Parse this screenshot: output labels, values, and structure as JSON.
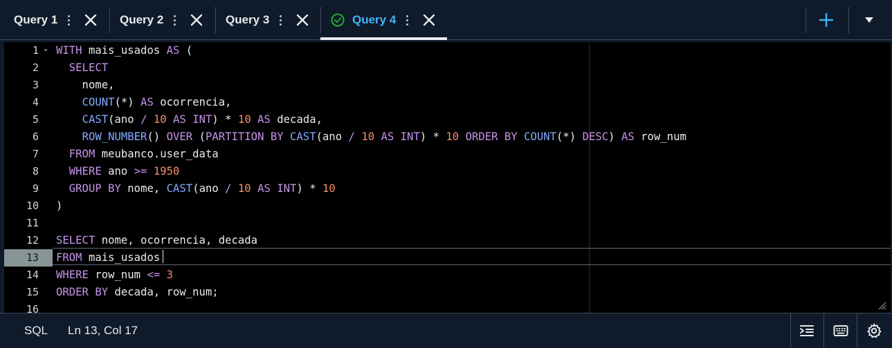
{
  "tabs": [
    {
      "label": "Query 1",
      "active": false
    },
    {
      "label": "Query 2",
      "active": false
    },
    {
      "label": "Query 3",
      "active": false
    },
    {
      "label": "Query 4",
      "active": true,
      "status_icon": "check-circle-icon"
    }
  ],
  "tabbar_actions": {
    "add_icon": "plus-icon",
    "more_icon": "caret-down-icon"
  },
  "editor": {
    "line_numbers": [
      "1",
      "2",
      "3",
      "4",
      "5",
      "6",
      "7",
      "8",
      "9",
      "10",
      "11",
      "12",
      "13",
      "14",
      "15",
      "16"
    ],
    "active_line": 13,
    "lines": [
      "WITH mais_usados AS (",
      "  SELECT",
      "    nome,",
      "    COUNT(*) AS ocorrencia,",
      "    CAST(ano / 10 AS INT) * 10 AS decada,",
      "    ROW_NUMBER() OVER (PARTITION BY CAST(ano / 10 AS INT) * 10 ORDER BY COUNT(*) DESC) AS row_num",
      "  FROM meubanco.user_data",
      "  WHERE ano >= 1950",
      "  GROUP BY nome, CAST(ano / 10 AS INT) * 10",
      ")",
      "",
      "SELECT nome, ocorrencia, decada",
      "FROM mais_usados",
      "WHERE row_num <= 3",
      "ORDER BY decada, row_num;",
      ""
    ]
  },
  "statusbar": {
    "language": "SQL",
    "cursor_position": "Ln 13, Col 17",
    "icons": [
      "indent-icon",
      "keyboard-icon",
      "settings-gear-icon"
    ]
  },
  "colors": {
    "accent": "#42b4ff",
    "success": "#29ad32",
    "keyword": "#c792ea",
    "function": "#82aaff",
    "number": "#f78c6c"
  }
}
